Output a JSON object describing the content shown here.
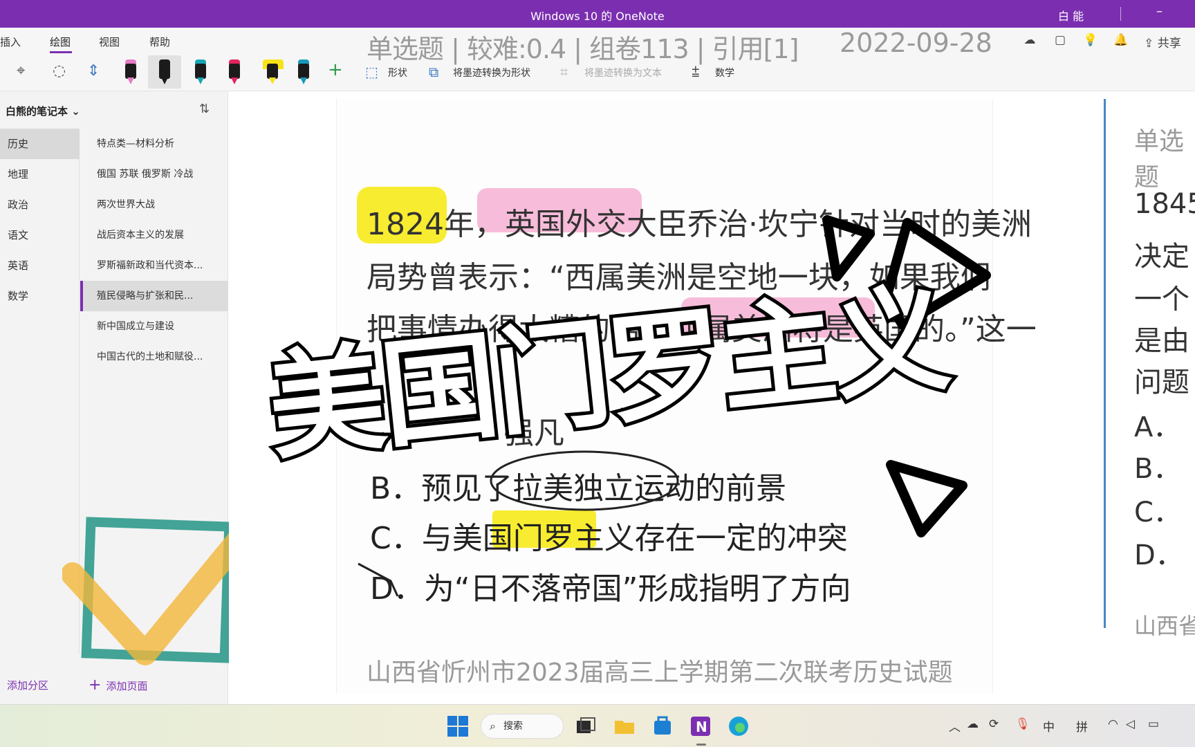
{
  "window": {
    "title": "Windows 10 的 OneNote",
    "user": "白 能"
  },
  "menu": {
    "items": [
      "插入",
      "绘图",
      "视图",
      "帮助"
    ],
    "active": "绘图",
    "share_label": "共享"
  },
  "ribbon": {
    "shape_label": "形状",
    "ink_to_shape": "将墨迹转换为形状",
    "ink_to_text": "将墨迹转换为文本",
    "math_label": "数学",
    "pens": [
      {
        "name": "black-pink",
        "cap": "#e67bc5"
      },
      {
        "name": "black",
        "cap": "#1b1b1b"
      },
      {
        "name": "teal",
        "cap": "#17a6b5"
      },
      {
        "name": "red",
        "cap": "#e0245e"
      },
      {
        "name": "yellow-highlighter",
        "cap": "#f7e31a"
      },
      {
        "name": "teal-2",
        "cap": "#1a9ab8"
      }
    ]
  },
  "sidebar": {
    "notebook": "白熊的笔记本",
    "sections": [
      "历史",
      "地理",
      "政治",
      "语文",
      "英语",
      "数学"
    ],
    "active_section": "历史",
    "pages": [
      "特点类—材料分析",
      "俄国 苏联 俄罗斯 冷战",
      "两次世界大战",
      "战后资本主义的发展",
      "罗斯福新政和当代资本...",
      "殖民侵略与扩张和民...",
      "新中国成立与建设",
      "中国古代的土地和赋役..."
    ],
    "active_page": "殖民侵略与扩张和民...",
    "add_section": "添加分区",
    "add_page": "添加页面"
  },
  "question": {
    "meta": "单选题 | 较难:0.4 | 组卷113 | 引用[1]",
    "date": "2022-09-28",
    "lines": [
      "1824年，英国外交大臣乔治·坎宁针对当时的美洲",
      "局势曾表示：“西属美洲是空地一块，如果我们",
      "把事情办得太糟的话，西属美洲将是英国的。”这一"
    ],
    "partial_option_a": "强凡",
    "options": [
      "B．预见了拉美独立运动的前景",
      "C．与美国门罗主义存在一定的冲突",
      "D．为“日不落帝国”形成指明了方向"
    ],
    "source": "山西省忻州市2023届高三上学期第二次联考历史试题"
  },
  "right_column": {
    "meta": "单选题",
    "lines": [
      "1845",
      "决定",
      "一个",
      "是由",
      "问题",
      "A．",
      "B．",
      "C．",
      "D．",
      "山西省"
    ]
  },
  "overlay": {
    "title": "美国门罗主义"
  },
  "taskbar": {
    "search_label": "搜索",
    "tray_text": [
      "中",
      "拼"
    ]
  }
}
